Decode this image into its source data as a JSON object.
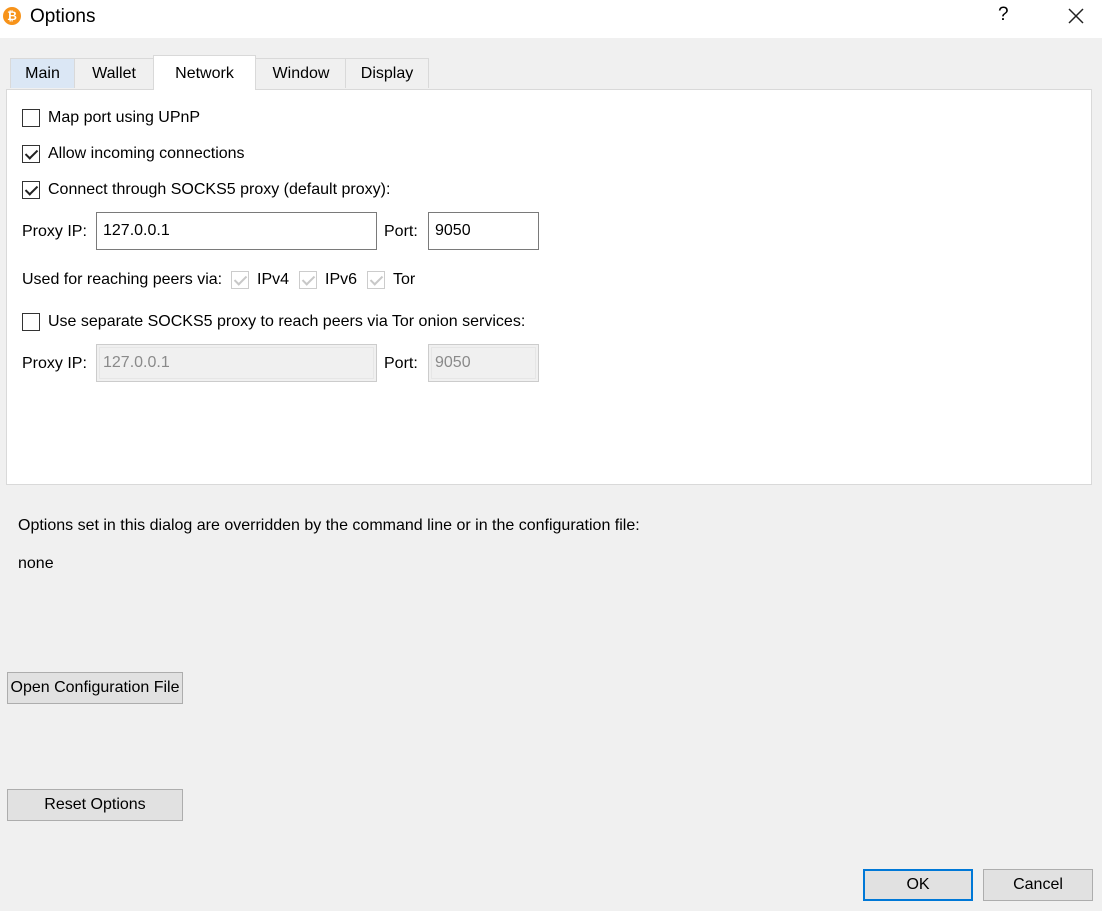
{
  "window": {
    "title": "Options",
    "icon": "bitcoin-icon",
    "help_label": "?",
    "close_icon": "close-icon"
  },
  "tabs": [
    {
      "label": "Main"
    },
    {
      "label": "Wallet"
    },
    {
      "label": "Network",
      "active": true
    },
    {
      "label": "Window"
    },
    {
      "label": "Display"
    }
  ],
  "network": {
    "map_port_upnp": {
      "label": "Map port using UPnP",
      "checked": false
    },
    "allow_incoming": {
      "label": "Allow incoming connections",
      "checked": true
    },
    "connect_socks5": {
      "label": "Connect through SOCKS5 proxy (default proxy):",
      "checked": true
    },
    "proxy": {
      "ip_label": "Proxy IP:",
      "ip_value": "127.0.0.1",
      "port_label": "Port:",
      "port_value": "9050"
    },
    "reach_peers": {
      "label": "Used for reaching peers via:",
      "ipv4": {
        "label": "IPv4",
        "checked": true,
        "enabled": false
      },
      "ipv6": {
        "label": "IPv6",
        "checked": true,
        "enabled": false
      },
      "tor": {
        "label": "Tor",
        "checked": true,
        "enabled": false
      }
    },
    "separate_tor": {
      "label": "Use separate SOCKS5 proxy to reach peers via Tor onion services:",
      "checked": false
    },
    "tor_proxy": {
      "ip_label": "Proxy IP:",
      "ip_value": "127.0.0.1",
      "port_label": "Port:",
      "port_value": "9050",
      "enabled": false
    }
  },
  "overrides": {
    "text": "Options set in this dialog are overridden by the command line or in the configuration file:",
    "value": "none"
  },
  "buttons": {
    "open_config": "Open Configuration File",
    "reset": "Reset Options",
    "ok": "OK",
    "cancel": "Cancel"
  },
  "colors": {
    "accent": "#0078d7",
    "bitcoin": "#f7931a",
    "first_tab_highlight": "#dbe7f5"
  }
}
